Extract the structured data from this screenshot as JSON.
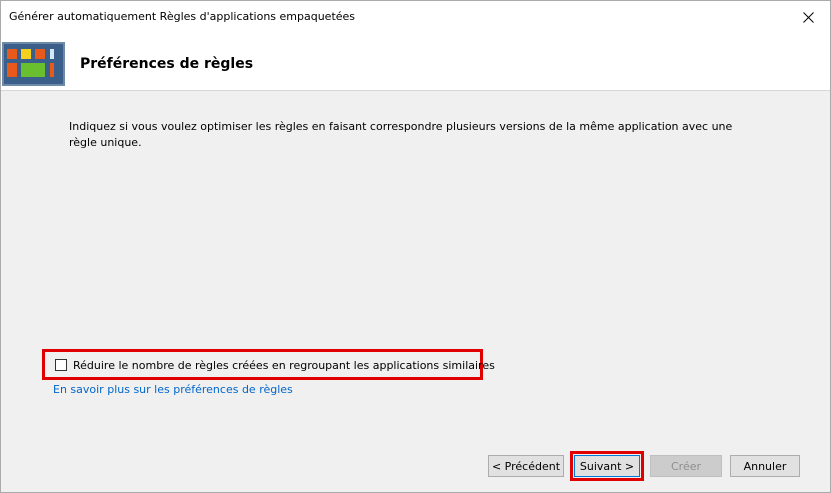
{
  "window": {
    "title": "Générer automatiquement Règles d'applications empaquetées",
    "close_icon": "close-icon"
  },
  "header": {
    "icon": "app-rules-icon",
    "title": "Préférences de règles"
  },
  "content": {
    "description": "Indiquez si vous voulez optimiser les règles en faisant correspondre plusieurs versions de la même application avec une règle unique.",
    "option": {
      "label": "Réduire le nombre de règles créées en regroupant les applications similaires",
      "checked": false
    },
    "link": "En savoir plus sur les préférences de règles"
  },
  "buttons": {
    "previous": "< Précédent",
    "next": "Suivant >",
    "create": "Créer",
    "cancel": "Annuler"
  },
  "colors": {
    "highlight": "#e00000",
    "link": "#0066cc",
    "dialog_bg": "#f0f0f0"
  }
}
